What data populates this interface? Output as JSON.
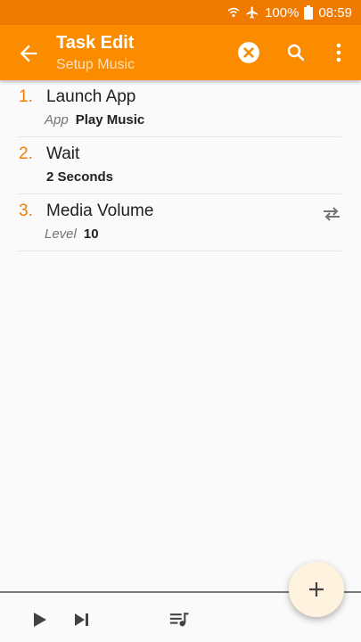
{
  "status_bar": {
    "battery_percent": "100%",
    "time": "08:59",
    "icons": [
      "wifi-calling-icon",
      "airplane-icon",
      "battery-icon"
    ]
  },
  "app_bar": {
    "title": "Task Edit",
    "subtitle": "Setup Music",
    "actions": [
      "back-arrow-icon",
      "clear-icon",
      "search-icon",
      "more-vert-icon"
    ],
    "color": "#fb8c00"
  },
  "actions": [
    {
      "number": "1.",
      "name": "Launch App",
      "param_label": "App",
      "param_value": "Play Music"
    },
    {
      "number": "2.",
      "name": "Wait",
      "param_label": "",
      "param_value": "2 Seconds"
    },
    {
      "number": "3.",
      "name": "Media Volume",
      "param_label": "Level",
      "param_value": "10"
    }
  ],
  "bottom_bar": {
    "icons": [
      "play-icon",
      "skip-next-icon",
      "queue-music-icon"
    ]
  },
  "fab": {
    "icon": "plus-icon"
  },
  "colors": {
    "accent": "#f57c00",
    "status_bar": "#f07a00",
    "fab_bg": "#fff3e0"
  }
}
